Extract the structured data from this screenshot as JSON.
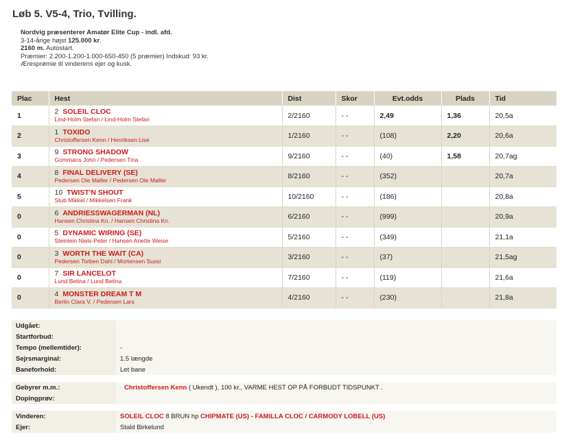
{
  "race_title": "Løb 5. V5-4, Trio, Tvilling.",
  "info": {
    "line1": "Nordvig præsenterer Amatør Elite Cup - indl. afd.",
    "line2_prefix": "3-14-årige højst ",
    "line2_amount": "125.000 kr",
    "line2_suffix": ".",
    "line3_dist": "2160 m.",
    "line3_rest": " Autostart.",
    "line4": "Præmier: 2.200-1.200-1.000-650-450 (5 præmier) Indskud: 93 kr.",
    "line5": "Æresprømie til vinderens ejer og kusk."
  },
  "table": {
    "headers": {
      "plac": "Plac",
      "hest": "Hest",
      "dist": "Dist",
      "skor": "Skor",
      "odds": "Evt.odds",
      "plads": "Plads",
      "tid": "Tid"
    },
    "rows": [
      {
        "plac": "1",
        "num": "2",
        "name": "SOLEIL CLOC",
        "sub": "Lind-Holm Stefan / Lind-Holm Stefan",
        "dist": "2/2160",
        "skor": "- -",
        "odds": "2,49",
        "plads": "1,36",
        "tid": "20,5a"
      },
      {
        "plac": "2",
        "num": "1",
        "name": "TOXIDO",
        "sub": "Christoffersen Kenn / Henriksen Lise",
        "dist": "1/2160",
        "skor": "- -",
        "odds": "(108)",
        "plads": "2,20",
        "tid": "20,6a"
      },
      {
        "plac": "3",
        "num": "9",
        "name": "STRONG SHADOW",
        "sub": "Gommans John / Pedersen Tina",
        "dist": "9/2160",
        "skor": "- -",
        "odds": "(40)",
        "plads": "1,58",
        "tid": "20,7ag"
      },
      {
        "plac": "4",
        "num": "8",
        "name": "FINAL DELIVERY (SE)",
        "sub": "Pedersen Ole Møller / Pedersen Ole Møller",
        "dist": "8/2160",
        "skor": "- -",
        "odds": "(352)",
        "plads": "",
        "tid": "20,7a"
      },
      {
        "plac": "5",
        "num": "10",
        "name": "TWIST'N SHOUT",
        "sub": "Stub Mikkel / Mikkelsen Frank",
        "dist": "10/2160",
        "skor": "- -",
        "odds": "(186)",
        "plads": "",
        "tid": "20,8a"
      },
      {
        "plac": "0",
        "num": "6",
        "name": "ANDRIESSWAGERMAN (NL)",
        "sub": "Hansen Christina Kn. / Hansen Christina Kn.",
        "dist": "6/2160",
        "skor": "- -",
        "odds": "(999)",
        "plads": "",
        "tid": "20,9a"
      },
      {
        "plac": "0",
        "num": "5",
        "name": "DYNAMIC WIRING (SE)",
        "sub": "Steinlein Niels-Peter / Hansen Anette Weise",
        "dist": "5/2160",
        "skor": "- -",
        "odds": "(349)",
        "plads": "",
        "tid": "21,1a"
      },
      {
        "plac": "0",
        "num": "3",
        "name": "WORTH THE WAIT (CA)",
        "sub": "Pedersen Torben Dahl / Mortensen Sussi",
        "dist": "3/2160",
        "skor": "- -",
        "odds": "(37)",
        "plads": "",
        "tid": "21,5ag"
      },
      {
        "plac": "0",
        "num": "7",
        "name": "SIR LANCELOT",
        "sub": "Lund Betina / Lund Betina",
        "dist": "7/2160",
        "skor": "- -",
        "odds": "(119)",
        "plads": "",
        "tid": "21,6a"
      },
      {
        "plac": "0",
        "num": "4",
        "name": "MONSTER DREAM T M",
        "sub": "Berlin Clara V. / Pedersen Lars",
        "dist": "4/2160",
        "skor": "- -",
        "odds": "(230)",
        "plads": "",
        "tid": "21,8a"
      }
    ]
  },
  "details": {
    "udgaaet_label": "Udgået:",
    "udgaaet_value": "",
    "startforbud_label": "Startforbud:",
    "startforbud_value": "",
    "tempo_label": "Tempo (mellemtider):",
    "tempo_value": "-",
    "sejrsmargin_label": "Sejrsmarginal:",
    "sejrsmargin_value": "1.5 længde",
    "baneforhold_label": "Baneforhold:",
    "baneforhold_value": "Let bane",
    "gebyrer_label": "Gebyrer m.m.:",
    "gebyrer_name": "Christoffersen Kenn",
    "gebyrer_rest": " ( Ukendt ), 100 kr., VARME HEST OP PÅ FORBUDT TIDSPUNKT .",
    "doping_label": "Dopingprøv:",
    "doping_value": "",
    "vinderen_label": "Vinderen:",
    "vinderen_name": "SOLEIL CLOC",
    "vinderen_mid": " 8 BRUN hp ",
    "vinderen_pedigree": "CHIPMATE (US) - FAMILLA CLOC / CARMODY LOBELL (US)",
    "ejer_label": "Ejer:",
    "ejer_value": "Stald Birkelund"
  }
}
